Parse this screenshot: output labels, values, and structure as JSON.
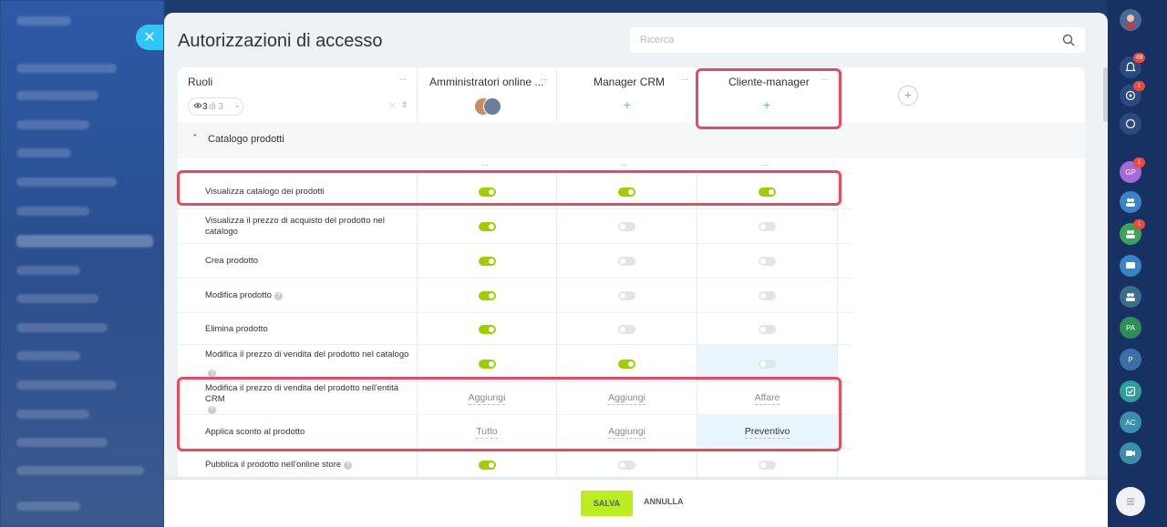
{
  "panel": {
    "title": "Autorizzazioni di accesso",
    "search_placeholder": "Ricerca"
  },
  "columns": {
    "roles_header": "Ruoli",
    "role_filter": {
      "count": "3",
      "of_total": "di 3"
    },
    "roles": [
      {
        "name": "Amministratori online ...",
        "has_avatars": true
      },
      {
        "name": "Manager CRM",
        "has_avatars": false
      },
      {
        "name": "Cliente-manager",
        "has_avatars": false
      }
    ]
  },
  "section": {
    "title": "Catalogo prodotti",
    "dots": "···"
  },
  "rows": [
    {
      "label": "Visualizza catalogo dei prodotti",
      "help": false,
      "values": [
        {
          "type": "toggle",
          "on": true
        },
        {
          "type": "toggle",
          "on": true
        },
        {
          "type": "toggle",
          "on": true
        }
      ]
    },
    {
      "label": "Visualizza il prezzo di acquisto del prodotto nel catalogo",
      "help": false,
      "values": [
        {
          "type": "toggle",
          "on": true
        },
        {
          "type": "toggle",
          "on": false
        },
        {
          "type": "toggle",
          "on": false
        }
      ]
    },
    {
      "label": "Crea prodotto",
      "help": false,
      "values": [
        {
          "type": "toggle",
          "on": true
        },
        {
          "type": "toggle",
          "on": false
        },
        {
          "type": "toggle",
          "on": false
        }
      ]
    },
    {
      "label": "Modifica prodotto",
      "help": true,
      "values": [
        {
          "type": "toggle",
          "on": true
        },
        {
          "type": "toggle",
          "on": false
        },
        {
          "type": "toggle",
          "on": false
        }
      ]
    },
    {
      "label": "Elimina prodotto",
      "help": false,
      "values": [
        {
          "type": "toggle",
          "on": true
        },
        {
          "type": "toggle",
          "on": false
        },
        {
          "type": "toggle",
          "on": false
        }
      ]
    },
    {
      "label": "Modifica il prezzo di vendita del prodotto nel catalogo",
      "help": true,
      "values": [
        {
          "type": "toggle",
          "on": true
        },
        {
          "type": "toggle",
          "on": true
        },
        {
          "type": "toggle",
          "on": false,
          "highlight": true
        }
      ]
    },
    {
      "label": "Modifica il prezzo di vendita del prodotto nell'entità CRM",
      "help": true,
      "values": [
        {
          "type": "text",
          "text": "Aggiungi"
        },
        {
          "type": "text",
          "text": "Aggiungi"
        },
        {
          "type": "text",
          "text": "Affare"
        }
      ]
    },
    {
      "label": "Applica sconto al prodotto",
      "help": false,
      "values": [
        {
          "type": "text",
          "text": "Tutto"
        },
        {
          "type": "text",
          "text": "Aggiungi"
        },
        {
          "type": "text",
          "text": "Preventivo",
          "highlight": true,
          "dark": true
        }
      ]
    },
    {
      "label": "Pubblica il prodotto nell'online store",
      "help": true,
      "values": [
        {
          "type": "toggle",
          "on": true
        },
        {
          "type": "toggle",
          "on": false
        },
        {
          "type": "toggle",
          "on": false
        }
      ]
    }
  ],
  "footer": {
    "save": "SALVA",
    "cancel": "ANNULLA"
  },
  "right_rail": {
    "notifications_badge": "49",
    "badges": [
      "1",
      "1",
      "1"
    ],
    "user_initials": [
      "GP",
      "PA",
      "P",
      "AC"
    ]
  },
  "colors": {
    "accent": "#2fc6f6",
    "toggle_on": "#9dcf00",
    "save_button": "#bbed21",
    "highlight_border": "#e84a5f"
  }
}
